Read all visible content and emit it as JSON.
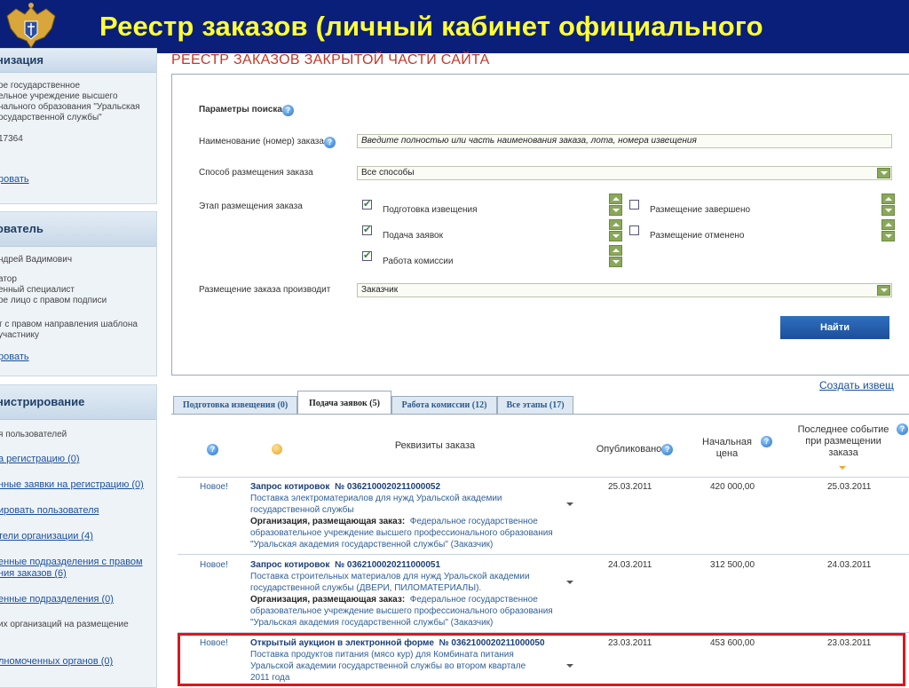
{
  "slide": {
    "title": "Реестр заказов (личный кабинет официального"
  },
  "sidebar": {
    "org": {
      "title": "низация",
      "lines": [
        "ое государственное",
        "ельное учреждение высшего",
        "нального образования \"Уральская",
        "осударственной службы\""
      ],
      "code": "17364",
      "link": "ровать"
    },
    "user": {
      "title": "ователь",
      "name": "ндрей Вадимович",
      "roles": [
        "атор",
        "енный специалист",
        "ое лицо с правом подписи"
      ],
      "rights": [
        "т с правом направления шаблона",
        "участнику"
      ],
      "link": "ровать"
    },
    "admin": {
      "title": "нистрирование",
      "items": [
        {
          "label": "я пользователей",
          "link": false
        },
        {
          "label": "а регистрацию (0)",
          "link": true
        },
        {
          "label": "нные заявки на регистрацию (0)",
          "link": true
        },
        {
          "label": "ировать пользователя",
          "link": true
        },
        {
          "label": "тели организации (4)",
          "link": true
        },
        {
          "label": "енные подразделения с правом",
          "label2": "ния заказов (6)",
          "link": true
        },
        {
          "label": "енные подразделения (0)",
          "link": true
        },
        {
          "label": "их организаций на размещение",
          "link": false
        },
        {
          "label": "лномоченных органов (0)",
          "link": true
        }
      ]
    }
  },
  "main": {
    "heading": "РЕЕСТР ЗАКАЗОВ ЗАКРЫТОЙ ЧАСТИ САЙТА",
    "search": {
      "params_label": "Параметры поиска",
      "name_label": "Наименование (номер) заказа",
      "name_placeholder": "Введите полностью или часть наименования заказа, лота, номера извещения",
      "method_label": "Способ размещения заказа",
      "method_value": "Все способы",
      "stage_label": "Этап размещения заказа",
      "stages": [
        {
          "label": "Подготовка извещения",
          "checked": true
        },
        {
          "label": "Подача заявок",
          "checked": true
        },
        {
          "label": "Работа комиссии",
          "checked": true
        },
        {
          "label": "Размещение завершено",
          "checked": false
        },
        {
          "label": "Размещение отменено",
          "checked": false
        }
      ],
      "placer_label": "Размещение заказа производит",
      "placer_value": "Заказчик",
      "find_label": "Найти"
    },
    "create_link": "Создать извещ",
    "tabs": [
      {
        "label": "Подготовка извещения (0)",
        "active": false
      },
      {
        "label": "Подача заявок (5)",
        "active": true
      },
      {
        "label": "Работа комиссии (12)",
        "active": false
      },
      {
        "label": "Все этапы (17)",
        "active": false
      }
    ],
    "table": {
      "headers": {
        "details": "Реквизиты заказа",
        "published": "Опубликовано",
        "price": "Начальная цена",
        "last_event": "Последнее событие при размещении заказа"
      },
      "org_label": "Организация, размещающая заказ:",
      "rows": [
        {
          "status": "Новое!",
          "type": "Запрос котировок",
          "number": "№  0362100020211000052",
          "desc": [
            "Поставка электроматериалов для нужд Уральской академии",
            "государственной службы"
          ],
          "org": [
            "Федеральное государственное",
            "образовательное учреждение высшего профессионального образования",
            "\"Уральская академия государственной службы\" (Заказчик)"
          ],
          "published": "25.03.2011",
          "price": "420 000,00",
          "last_event": "25.03.2011"
        },
        {
          "status": "Новое!",
          "type": "Запрос котировок",
          "number": "№  0362100020211000051",
          "desc": [
            "Поставка строительных материалов для нужд Уральской академии",
            "государственной службы (ДВЕРИ, ПИЛОМАТЕРИАЛЫ)."
          ],
          "org": [
            "Федеральное государственное",
            "образовательное учреждение высшего профессионального образования",
            "\"Уральская академия государственной службы\" (Заказчик)"
          ],
          "published": "24.03.2011",
          "price": "312 500,00",
          "last_event": "24.03.2011"
        },
        {
          "status": "Новое!",
          "type": "Открытый аукцион в электронной форме",
          "number": "№  0362100020211000050",
          "desc": [
            "Поставка продуктов питания (мясо кур) для Комбината питания",
            "Уральской академии государственной службы во втором квартале",
            "2011 года"
          ],
          "published": "23.03.2011",
          "price": "453 600,00",
          "last_event": "23.03.2011"
        }
      ]
    }
  },
  "colors": {
    "slide_bg": "#0a1f7a",
    "slide_title": "#ffff33",
    "heading": "#c0392b",
    "link": "#1a4f9c",
    "highlight": "#e0141e"
  }
}
